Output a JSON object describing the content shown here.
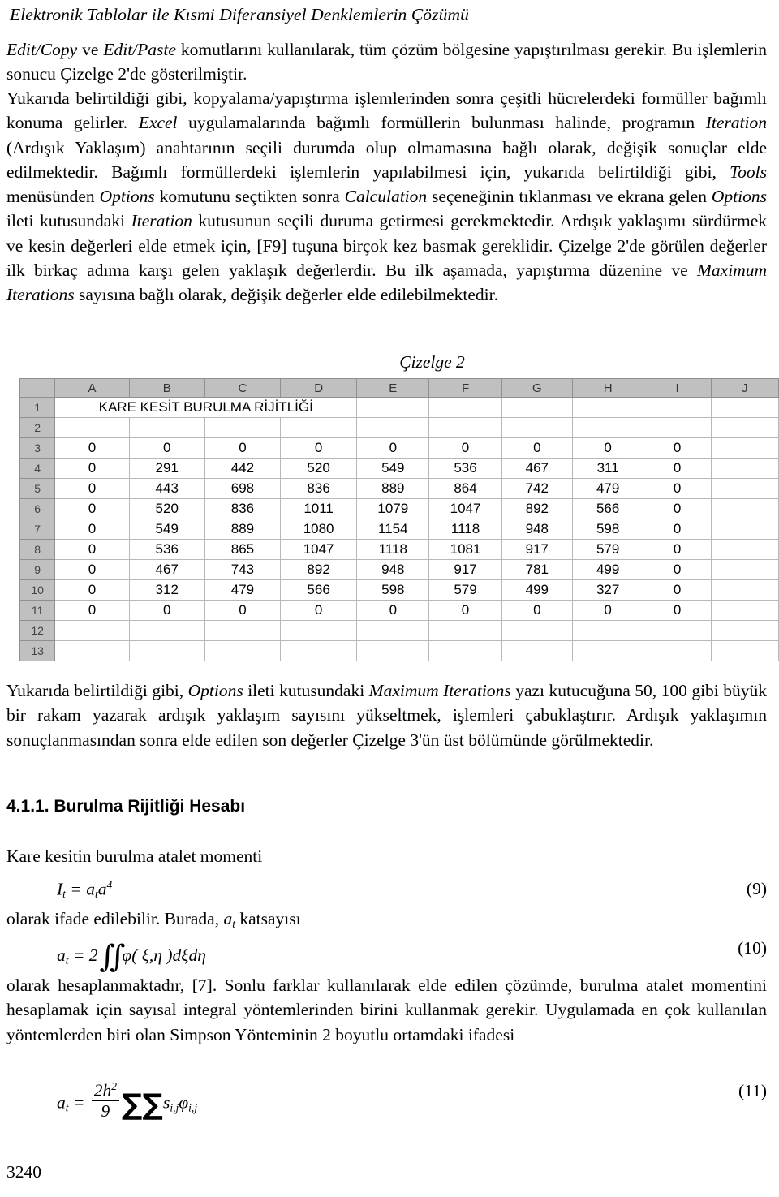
{
  "running_head": "Elektronik Tablolar ile Kısmi Diferansiyel Denklemlerin Çözümü",
  "paragraphs": {
    "p1_pre_a": "",
    "p1_italic_a": "Edit/Copy",
    "p1_mid_a": " ve ",
    "p1_italic_b": "Edit/Paste",
    "p1_rest": " komutlarını kullanılarak, tüm çözüm bölgesine yapıştırılması gerekir. Bu işlemlerin sonucu Çizelge 2'de gösterilmiştir.",
    "p2_seg1": "Yukarıda belirtildiği gibi, kopyalama/yapıştırma işlemlerinden sonra çeşitli hücrelerdeki formüller bağımlı konuma gelirler. ",
    "p2_it1": "Excel",
    "p2_seg2": " uygulamalarında bağımlı formüllerin bulunması halinde, programın ",
    "p2_it2": "Iteration",
    "p2_seg3": " (Ardışık Yaklaşım) anahtarının seçili durumda olup olmamasına bağlı olarak, değişik sonuçlar elde edilmektedir. Bağımlı formüllerdeki işlemlerin yapılabilmesi için, yukarıda belirtildiği gibi, ",
    "p2_it3": "Tools",
    "p2_seg4": " menüsünden ",
    "p2_it4": "Options",
    "p2_seg5": " komutunu seçtikten sonra ",
    "p2_it5": "Calculation",
    "p2_seg6": " seçeneğinin tıklanması ve ekrana gelen ",
    "p2_it6": "Options",
    "p2_seg7": " ileti kutusundaki ",
    "p2_it7": "Iteration",
    "p2_seg8": " kutusunun seçili duruma getirmesi gerekmektedir. Ardışık yaklaşımı sürdürmek ve kesin değerleri elde etmek için, [F9] tuşuna birçok kez basmak gereklidir. Çizelge 2'de görülen değerler ilk birkaç adıma karşı gelen yaklaşık değerlerdir. Bu ilk aşamada, yapıştırma düzenine ve ",
    "p2_it8": "Maximum Iterations",
    "p2_seg9": " sayısına bağlı olarak, değişik değerler elde edilebilmektedir.",
    "p3_seg1": "Yukarıda belirtildiği gibi, ",
    "p3_it1": "Options",
    "p3_seg2": " ileti kutusundaki ",
    "p3_it2": "Maximum Iterations",
    "p3_seg3": " yazı kutucuğuna 50, 100 gibi büyük bir rakam yazarak ardışık yaklaşım sayısını yükseltmek, işlemleri çabuklaştırır. Ardışık yaklaşımın sonuçlanmasından sonra elde edilen son değerler Çizelge 3'ün üst bölümünde görülmektedir.",
    "p4_seg1": "olarak ifade edilebilir. Burada, ",
    "p4_it1": "a",
    "p4_sub1": "t",
    "p4_seg2": " katsayısı",
    "p5_text": "olarak hesaplanmaktadır, [7]. Sonlu farklar kullanılarak elde edilen çözümde, burulma atalet momentini hesaplamak için sayısal integral yöntemlerinden birini kullanmak gerekir. Uygulamada en çok kullanılan yöntemlerden biri olan Simpson Yönteminin 2 boyutlu ortamdaki ifadesi"
  },
  "table_caption": "Çizelge 2",
  "section_heading": "4.1.1. Burulma Rijitliği Hesabı",
  "eq_intro": "Kare kesitin burulma atalet momenti",
  "equations": {
    "eq9": {
      "number": "(9)",
      "lhs_var": "I",
      "lhs_sub": "t",
      "eq": "=",
      "rhs_a": "a",
      "rhs_sub": "t",
      "rhs_b": "a",
      "rhs_sup": "4"
    },
    "eq10": {
      "number": "(10)",
      "lhs_var": "a",
      "lhs_sub": "t",
      "eq": "=",
      "coef": "2",
      "integral": "∬",
      "body": "φ( ξ,η )dξdη"
    },
    "eq11": {
      "number": "(11)",
      "lhs_var": "a",
      "lhs_sub": "t",
      "eq": "=",
      "num": "2h",
      "num_sup": "2",
      "den": "9",
      "sum1": "∑",
      "sum2": "∑",
      "term_s": "s",
      "term_s_sub": "i,j",
      "term_phi": "φ",
      "term_phi_sub": "i,j"
    }
  },
  "page_number": "3240",
  "spreadsheet": {
    "columns": [
      "A",
      "B",
      "C",
      "D",
      "E",
      "F",
      "G",
      "H",
      "I",
      "J"
    ],
    "row_labels": [
      "1",
      "2",
      "3",
      "4",
      "5",
      "6",
      "7",
      "8",
      "9",
      "10",
      "11",
      "12",
      "13"
    ],
    "title_cell": "KARE KESİT BURULMA RİJİTLİĞİ",
    "rows": [
      {
        "label": "1",
        "title": "KARE KESİT BURULMA RİJİTLİĞİ",
        "cells": [
          "",
          "",
          "",
          "",
          "",
          "",
          "",
          "",
          "",
          ""
        ]
      },
      {
        "label": "2",
        "cells": [
          "",
          "",
          "",
          "",
          "",
          "",
          "",
          "",
          "",
          ""
        ]
      },
      {
        "label": "3",
        "cells": [
          "0",
          "0",
          "0",
          "0",
          "0",
          "0",
          "0",
          "0",
          "0",
          ""
        ]
      },
      {
        "label": "4",
        "cells": [
          "0",
          "291",
          "442",
          "520",
          "549",
          "536",
          "467",
          "311",
          "0",
          ""
        ]
      },
      {
        "label": "5",
        "cells": [
          "0",
          "443",
          "698",
          "836",
          "889",
          "864",
          "742",
          "479",
          "0",
          ""
        ]
      },
      {
        "label": "6",
        "cells": [
          "0",
          "520",
          "836",
          "1011",
          "1079",
          "1047",
          "892",
          "566",
          "0",
          ""
        ]
      },
      {
        "label": "7",
        "cells": [
          "0",
          "549",
          "889",
          "1080",
          "1154",
          "1118",
          "948",
          "598",
          "0",
          ""
        ]
      },
      {
        "label": "8",
        "cells": [
          "0",
          "536",
          "865",
          "1047",
          "1118",
          "1081",
          "917",
          "579",
          "0",
          ""
        ]
      },
      {
        "label": "9",
        "cells": [
          "0",
          "467",
          "743",
          "892",
          "948",
          "917",
          "781",
          "499",
          "0",
          ""
        ]
      },
      {
        "label": "10",
        "cells": [
          "0",
          "312",
          "479",
          "566",
          "598",
          "579",
          "499",
          "327",
          "0",
          ""
        ]
      },
      {
        "label": "11",
        "cells": [
          "0",
          "0",
          "0",
          "0",
          "0",
          "0",
          "0",
          "0",
          "0",
          ""
        ]
      },
      {
        "label": "12",
        "cells": [
          "",
          "",
          "",
          "",
          "",
          "",
          "",
          "",
          "",
          ""
        ]
      },
      {
        "label": "13",
        "cells": [
          "",
          "",
          "",
          "",
          "",
          "",
          "",
          "",
          "",
          ""
        ]
      }
    ]
  }
}
